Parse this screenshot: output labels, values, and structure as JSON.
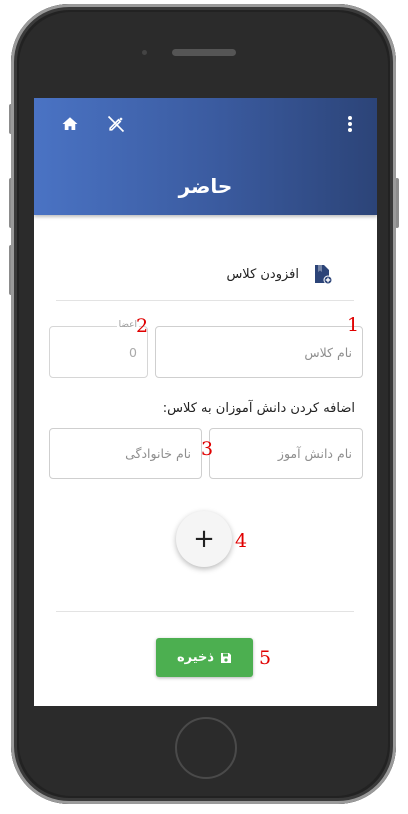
{
  "app": {
    "title": "حاضر"
  },
  "header": {
    "home_icon": "home-icon",
    "edit_off_icon": "edit-off-icon",
    "menu_icon": "more-vert-icon"
  },
  "section": {
    "title": "افزودن کلاس",
    "icon": "add-document-icon"
  },
  "class_form": {
    "class_name_placeholder": "نام کلاس",
    "members_label": "اعضا",
    "members_value": "0"
  },
  "students": {
    "section_label": "اضافه کردن دانش آموزان به کلاس:",
    "student_name_placeholder": "نام دانش آموز",
    "family_name_placeholder": "نام خانوادگی"
  },
  "add_button": {
    "label": "+"
  },
  "save_button": {
    "label": "ذخیره",
    "icon": "save-icon"
  },
  "annotations": [
    "1",
    "2",
    "3",
    "4",
    "5"
  ],
  "colors": {
    "appbar_start": "#4a73c4",
    "appbar_end": "#2c4478",
    "save": "#4caf50",
    "marker": "#e00000"
  }
}
